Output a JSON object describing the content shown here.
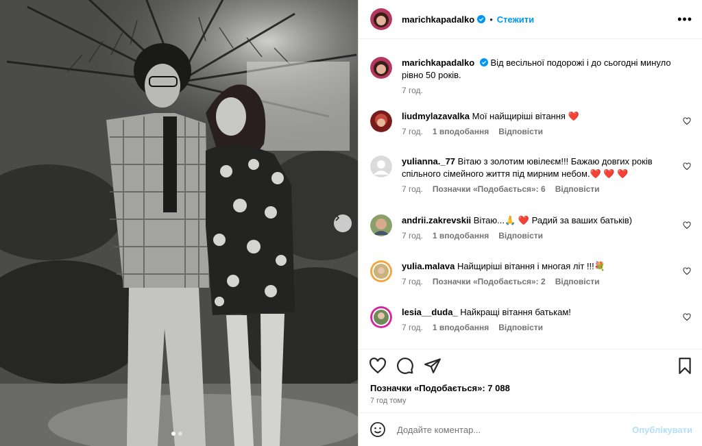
{
  "post": {
    "username": "marichkapadalko",
    "follow_label": "Стежити",
    "separator": "•",
    "more_icon": "more-horizontal-icon"
  },
  "caption": {
    "username": "marichkapadalko",
    "text": "Від весільної подорожі і до сьогодні минуло рівно 50 років.",
    "time": "7 год."
  },
  "comments": [
    {
      "username": "liudmylazavalka",
      "text": "Мої найщиріші вітання ❤️",
      "time": "7 год.",
      "likes": "1 вподобання",
      "reply": "Відповісти"
    },
    {
      "username": "yulianna._77",
      "text": "Вітаю з золотим ювілеєм!!! Бажаю довгих років спільного сімейного життя під мирним небом.❤️ ❤️ ❤️",
      "time": "7 год.",
      "likes": "Позначки «Подобається»: 6",
      "reply": "Відповісти"
    },
    {
      "username": "andrii.zakrevskii",
      "text": "Вітаю...🙏 ❤️  Радий за ваших батьків)",
      "time": "7 год.",
      "likes": "1 вподобання",
      "reply": "Відповісти"
    },
    {
      "username": "yulia.malava",
      "text": "Найщиріші вітання і многая літ !!!💐",
      "time": "7 год.",
      "likes": "Позначки «Подобається»: 2",
      "reply": "Відповісти"
    },
    {
      "username": "lesia__duda_",
      "text": "Найкращі вітання батькам!",
      "time": "7 год.",
      "likes": "1 вподобання",
      "reply": "Відповісти"
    }
  ],
  "footer": {
    "likes": "Позначки «Подобається»: 7 088",
    "time": "7 год тому",
    "comment_placeholder": "Додайте коментар...",
    "publish_label": "Опублікувати"
  },
  "colors": {
    "link": "#0095f6",
    "publish_disabled": "#b2dffc",
    "muted": "#737373",
    "heart": "#ed4956"
  },
  "carousel": {
    "current": 1,
    "total": 2
  }
}
